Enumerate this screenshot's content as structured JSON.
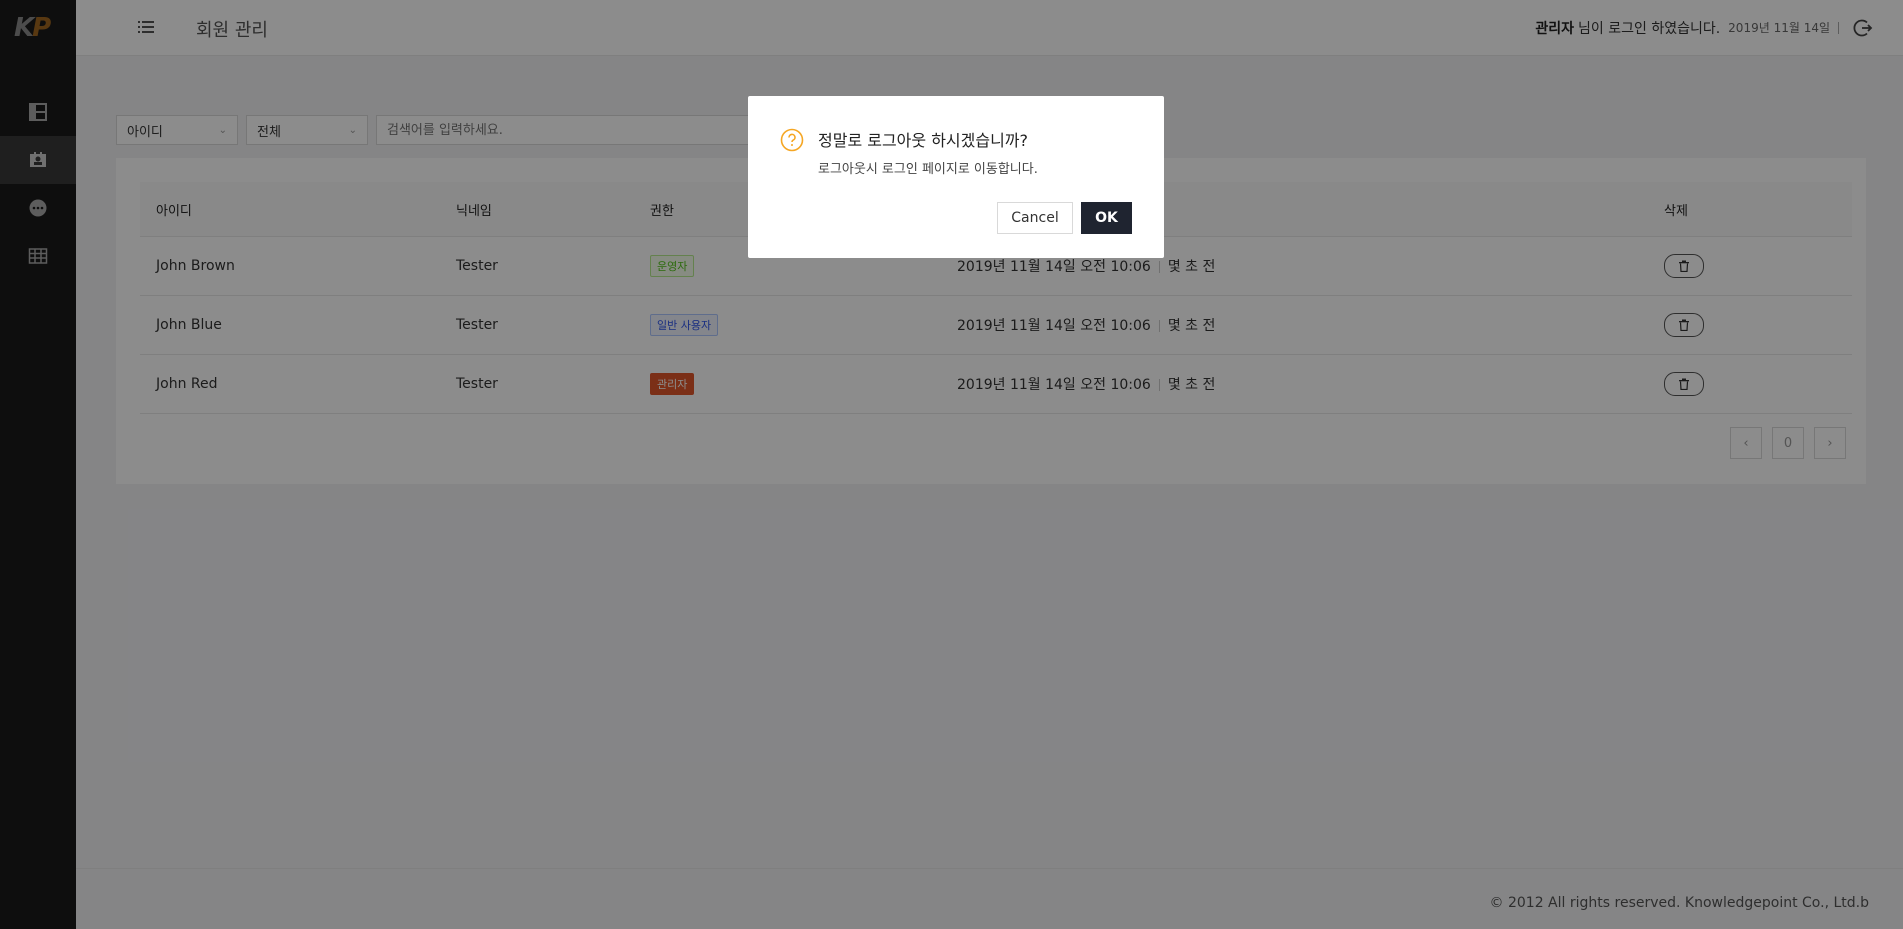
{
  "logo": {
    "k": "K",
    "p": "P"
  },
  "sidebar": {
    "items": [
      {
        "icon": "dashboard-icon",
        "active": false
      },
      {
        "icon": "member-icon",
        "active": true
      },
      {
        "icon": "chat-icon",
        "active": false
      },
      {
        "icon": "table-icon",
        "active": false
      }
    ]
  },
  "header": {
    "title": "회원 관리",
    "user": "관리자",
    "message": "님이 로그인 하였습니다.",
    "date": "2019년 11월 14일"
  },
  "filters": {
    "field_select": "아이디",
    "scope_select": "전체",
    "search_placeholder": "검색어를 입력하세요."
  },
  "table": {
    "headers": {
      "id": "아이디",
      "nickname": "닉네임",
      "role": "권한",
      "delete": "삭제"
    },
    "rows": [
      {
        "id": "John Brown",
        "nickname": "Tester",
        "role": "운영자",
        "date": "2019년 11월 14일 오전 10:06",
        "ago": "몇 초 전"
      },
      {
        "id": "John Blue",
        "nickname": "Tester",
        "role": "일반 사용자",
        "date": "2019년 11월 14일 오전 10:06",
        "ago": "몇 초 전"
      },
      {
        "id": "John Red",
        "nickname": "Tester",
        "role": "관리자",
        "date": "2019년 11월 14일 오전 10:06",
        "ago": "몇 초 전"
      }
    ]
  },
  "pagination": {
    "current": "0"
  },
  "footer": {
    "copyright": "© 2012 All rights reserved. Knowledgepoint Co., Ltd.b"
  },
  "modal": {
    "title": "정말로 로그아웃 하시겠습니까?",
    "content": "로그아웃시 로그인 페이지로 이동합니다.",
    "cancel": "Cancel",
    "ok": "OK"
  },
  "colors": {
    "overlay": "rgba(0,0,0,0.45)",
    "ok_button": "#1f2430",
    "question_icon": "#f5a623"
  }
}
